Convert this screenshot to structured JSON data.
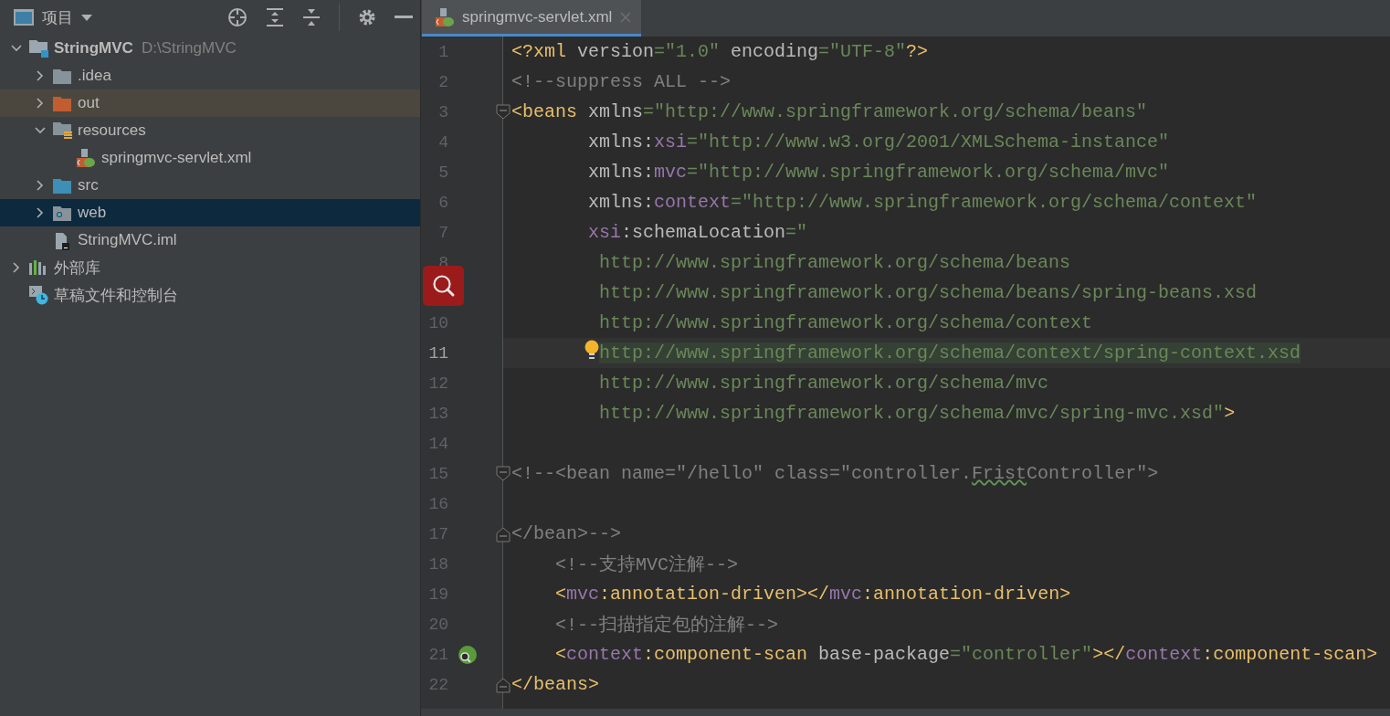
{
  "project_panel": {
    "title": "项目",
    "tree": [
      {
        "kind": "module",
        "name": "StringMVC",
        "path": "D:\\StringMVC",
        "expanded": true,
        "selected": false,
        "excluded": false,
        "children": [
          {
            "kind": "folder",
            "name": ".idea",
            "expanded": false,
            "selected": false,
            "excluded": false
          },
          {
            "kind": "excluded-folder",
            "name": "out",
            "expanded": false,
            "selected": false,
            "excluded": true
          },
          {
            "kind": "resource-folder",
            "name": "resources",
            "expanded": true,
            "selected": false,
            "excluded": false,
            "children": [
              {
                "kind": "spring-xml",
                "name": "springmvc-servlet.xml",
                "selected": false,
                "excluded": false
              }
            ]
          },
          {
            "kind": "source-folder",
            "name": "src",
            "expanded": false,
            "selected": false,
            "excluded": false
          },
          {
            "kind": "web-folder",
            "name": "web",
            "expanded": false,
            "selected": true,
            "excluded": false
          },
          {
            "kind": "iml-file",
            "name": "StringMVC.iml",
            "selected": false,
            "excluded": false
          }
        ]
      },
      {
        "kind": "libraries",
        "name": "外部库",
        "expanded": false,
        "selected": false,
        "excluded": false
      },
      {
        "kind": "scratches",
        "name": "草稿文件和控制台",
        "selected": false,
        "excluded": false
      }
    ]
  },
  "editor": {
    "tabs": [
      {
        "kind": "spring-xml",
        "label": "springmvc-servlet.xml",
        "selected": true
      }
    ],
    "lines": [
      {
        "kind": "top",
        "number": "1",
        "current": false,
        "tokens": [
          {
            "kind": "tag",
            "text": "<?xml "
          },
          {
            "kind": "attr",
            "text": "version"
          },
          {
            "kind": "val",
            "text": "=\"1.0\""
          },
          {
            "kind": "attr",
            "text": " encoding"
          },
          {
            "kind": "val",
            "text": "=\"UTF-8\""
          },
          {
            "kind": "tag",
            "text": "?>"
          }
        ]
      },
      {
        "kind": "top",
        "number": "2",
        "current": false,
        "tokens": [
          {
            "kind": "comment",
            "text": "<!--suppress ALL -->"
          }
        ]
      },
      {
        "kind": "top",
        "number": "3",
        "current": false,
        "fold_start": true,
        "tokens": [
          {
            "kind": "tag",
            "text": "<beans "
          },
          {
            "kind": "attr",
            "text": "xmlns"
          },
          {
            "kind": "val",
            "text": "=\"http://www.springframework.org/schema/beans\""
          }
        ]
      },
      {
        "kind": "attribute",
        "number": "4",
        "current": false,
        "tokens": [
          {
            "kind": "attr",
            "text": "xmlns:"
          },
          {
            "kind": "ns",
            "text": "xsi"
          },
          {
            "kind": "val",
            "text": "=\"http://www.w3.org/2001/XMLSchema-instance\""
          }
        ]
      },
      {
        "kind": "attribute",
        "number": "5",
        "current": false,
        "tokens": [
          {
            "kind": "attr",
            "text": "xmlns:"
          },
          {
            "kind": "ns",
            "text": "mvc"
          },
          {
            "kind": "val",
            "text": "=\"http://www.springframework.org/schema/mvc\""
          }
        ]
      },
      {
        "kind": "attribute",
        "number": "6",
        "current": false,
        "tokens": [
          {
            "kind": "attr",
            "text": "xmlns:"
          },
          {
            "kind": "ns",
            "text": "context"
          },
          {
            "kind": "val",
            "text": "=\"http://www.springframework.org/schema/context\""
          }
        ]
      },
      {
        "kind": "attribute",
        "number": "7",
        "current": false,
        "tokens": [
          {
            "kind": "ns",
            "text": "xsi"
          },
          {
            "kind": "attr",
            "text": ":schemaLocation"
          },
          {
            "kind": "val",
            "text": "=\""
          }
        ]
      },
      {
        "kind": "schema",
        "number": "8",
        "current": false,
        "tokens": [
          {
            "kind": "val",
            "text": "http://www.springframework.org/schema/beans"
          }
        ]
      },
      {
        "kind": "schema",
        "tokens": [
          {
            "kind": "val",
            "text": "http://www.springframework.org/schema/beans/spring-beans.xsd"
          }
        ]
      },
      {
        "kind": "schema",
        "number": "10",
        "current": false,
        "tokens": [
          {
            "kind": "val",
            "text": "http://www.springframework.org/schema/context"
          }
        ]
      },
      {
        "kind": "schema",
        "number": "11",
        "current": true,
        "intention": true,
        "tokens": [
          {
            "kind": "val-marked",
            "text": "http://www.springframework.org/schema/context/spring-context.xsd"
          }
        ]
      },
      {
        "kind": "schema",
        "number": "12",
        "current": false,
        "tokens": [
          {
            "kind": "val",
            "text": "http://www.springframework.org/schema/mvc"
          }
        ]
      },
      {
        "kind": "schema",
        "number": "13",
        "current": false,
        "tokens": [
          {
            "kind": "val",
            "text": "http://www.springframework.org/schema/mvc/spring-mvc.xsd\""
          },
          {
            "kind": "tag",
            "text": ">"
          }
        ]
      },
      {
        "number": "14",
        "current": false
      },
      {
        "kind": "top",
        "number": "15",
        "current": false,
        "fold_start": true,
        "tokens": [
          {
            "kind": "comment",
            "text": "<!--<bean name=\"/hello\" class=\"controller."
          },
          {
            "kind": "typo",
            "text": "Frist"
          },
          {
            "kind": "comment",
            "text": "Controller\">"
          }
        ]
      },
      {
        "number": "16",
        "current": false
      },
      {
        "kind": "top",
        "number": "17",
        "current": false,
        "fold_end": true,
        "tokens": [
          {
            "kind": "comment",
            "text": "</bean>-->"
          }
        ]
      },
      {
        "kind": "child",
        "number": "18",
        "current": false,
        "tokens": [
          {
            "kind": "comment",
            "text": "<!--支持MVC注解-->"
          }
        ]
      },
      {
        "kind": "child",
        "number": "19",
        "current": false,
        "tokens": [
          {
            "kind": "tag",
            "text": "<"
          },
          {
            "kind": "ns",
            "text": "mvc"
          },
          {
            "kind": "tag",
            "text": ":annotation-driven></"
          },
          {
            "kind": "ns",
            "text": "mvc"
          },
          {
            "kind": "tag",
            "text": ":annotation-driven>"
          }
        ]
      },
      {
        "kind": "child",
        "number": "20",
        "current": false,
        "tokens": [
          {
            "kind": "comment",
            "text": "<!--扫描指定包的注解-->"
          }
        ]
      },
      {
        "kind": "child",
        "number": "21",
        "current": false,
        "bean_marker": true,
        "tokens": [
          {
            "kind": "tag",
            "text": "<"
          },
          {
            "kind": "ns",
            "text": "context"
          },
          {
            "kind": "tag",
            "text": ":component-scan "
          },
          {
            "kind": "attr",
            "text": "base-package"
          },
          {
            "kind": "val",
            "text": "=\"controller\""
          },
          {
            "kind": "tag",
            "text": "></"
          },
          {
            "kind": "ns",
            "text": "context"
          },
          {
            "kind": "tag",
            "text": ":component-scan>"
          }
        ]
      },
      {
        "kind": "top",
        "number": "22",
        "current": false,
        "fold_end": true,
        "tokens": [
          {
            "kind": "tag",
            "text": "</beans>"
          }
        ]
      }
    ]
  }
}
